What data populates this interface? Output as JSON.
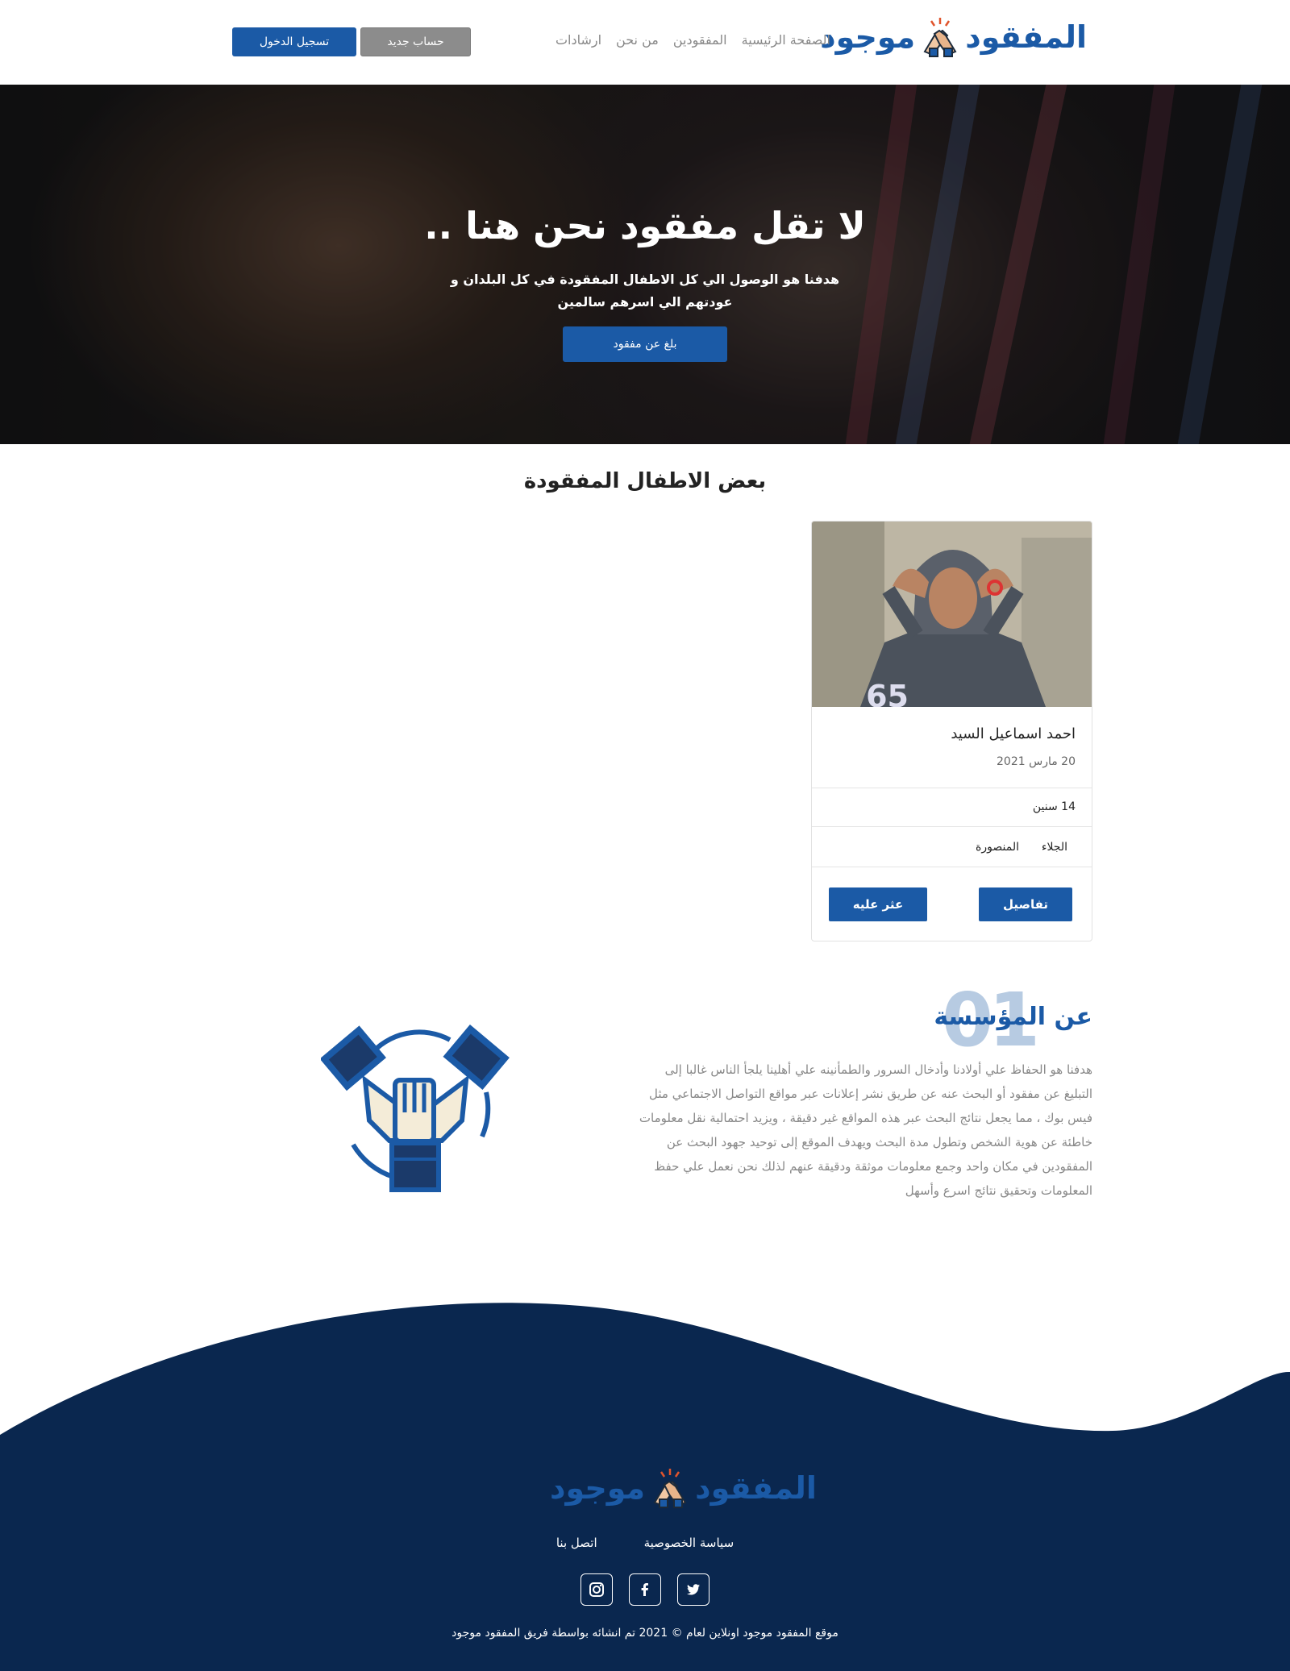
{
  "colors": {
    "brand": "#1b5aa6",
    "footer": "#0a274f",
    "muted_button": "#8c8c8c"
  },
  "header": {
    "logo_word_1": "المفقود",
    "logo_word_2": "موجود",
    "nav": [
      "الصفحة الرئيسية",
      "المفقودين",
      "من نحن",
      "ارشادات"
    ],
    "register_label": "حساب جديد",
    "login_label": "تسجيل الدخول"
  },
  "hero": {
    "title": "لا تقل مفقود نحن هنا ..",
    "subtitle": "هدفنا هو الوصول الي كل الاطفال المفقودة في كل البلدان و عودتهم الي اسرهم سالمين",
    "cta_label": "بلغ عن مفقود"
  },
  "missing": {
    "section_title": "بعض الاطفال المفقودة",
    "cards": [
      {
        "name": "احمد اسماعيل السيد",
        "date": "20 مارس 2021",
        "age": "14 سنين",
        "city": "المنصورة",
        "area": "الجلاء",
        "details_label": "تفاصيل",
        "found_label": "عثر عليه"
      }
    ]
  },
  "about": {
    "number": "01",
    "title": "عن المؤسسة",
    "text": "هدفنا هو الحفاظ علي أولادنا وأدخال السرور والطمأنينه علي أهلينا يلجأ الناس غالبا إلى التبليغ عن مفقود أو البحث عنه عن طريق نشر إعلانات عبر مواقع التواصل الاجتماعي مثل فيس بوك ، مما يجعل نتائج البحث عبر هذه المواقع غير دقيقة ، ويزيد احتمالية نقل معلومات خاطئة عن هوية الشخص وتطول مدة البحث ويهدف الموقع إلى توحيد جهود البحث عن المفقودين في مكان واحد وجمع معلومات موثقة ودقيقة عنهم لذلك نحن نعمل علي حفظ المعلومات وتحقيق نتائج اسرع وأسهل"
  },
  "footer": {
    "links": [
      "سياسة الخصوصية",
      "اتصل بنا"
    ],
    "socials": [
      "twitter-icon",
      "facebook-icon",
      "instagram-icon"
    ],
    "copyright": "موقع المفقود موجود اونلاين لعام © 2021 تم انشائه بواسطة فريق المفقود موجود"
  }
}
